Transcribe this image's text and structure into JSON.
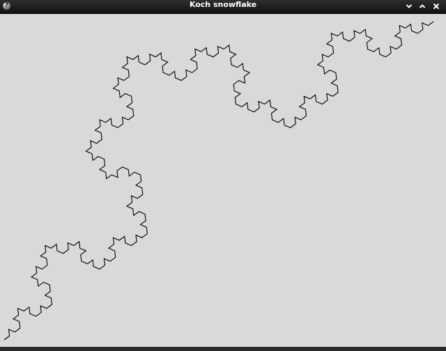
{
  "window": {
    "title": "Koch snowflake",
    "app_icon": "help-icon",
    "app_icon_glyph": "?",
    "controls": {
      "minimize_icon": "chevron-down-icon",
      "maximize_icon": "chevron-up-icon",
      "close_icon": "close-icon"
    }
  },
  "canvas": {
    "background": "#d9d9d9",
    "stroke_color": "#000000",
    "recursion_depth": 4
  }
}
